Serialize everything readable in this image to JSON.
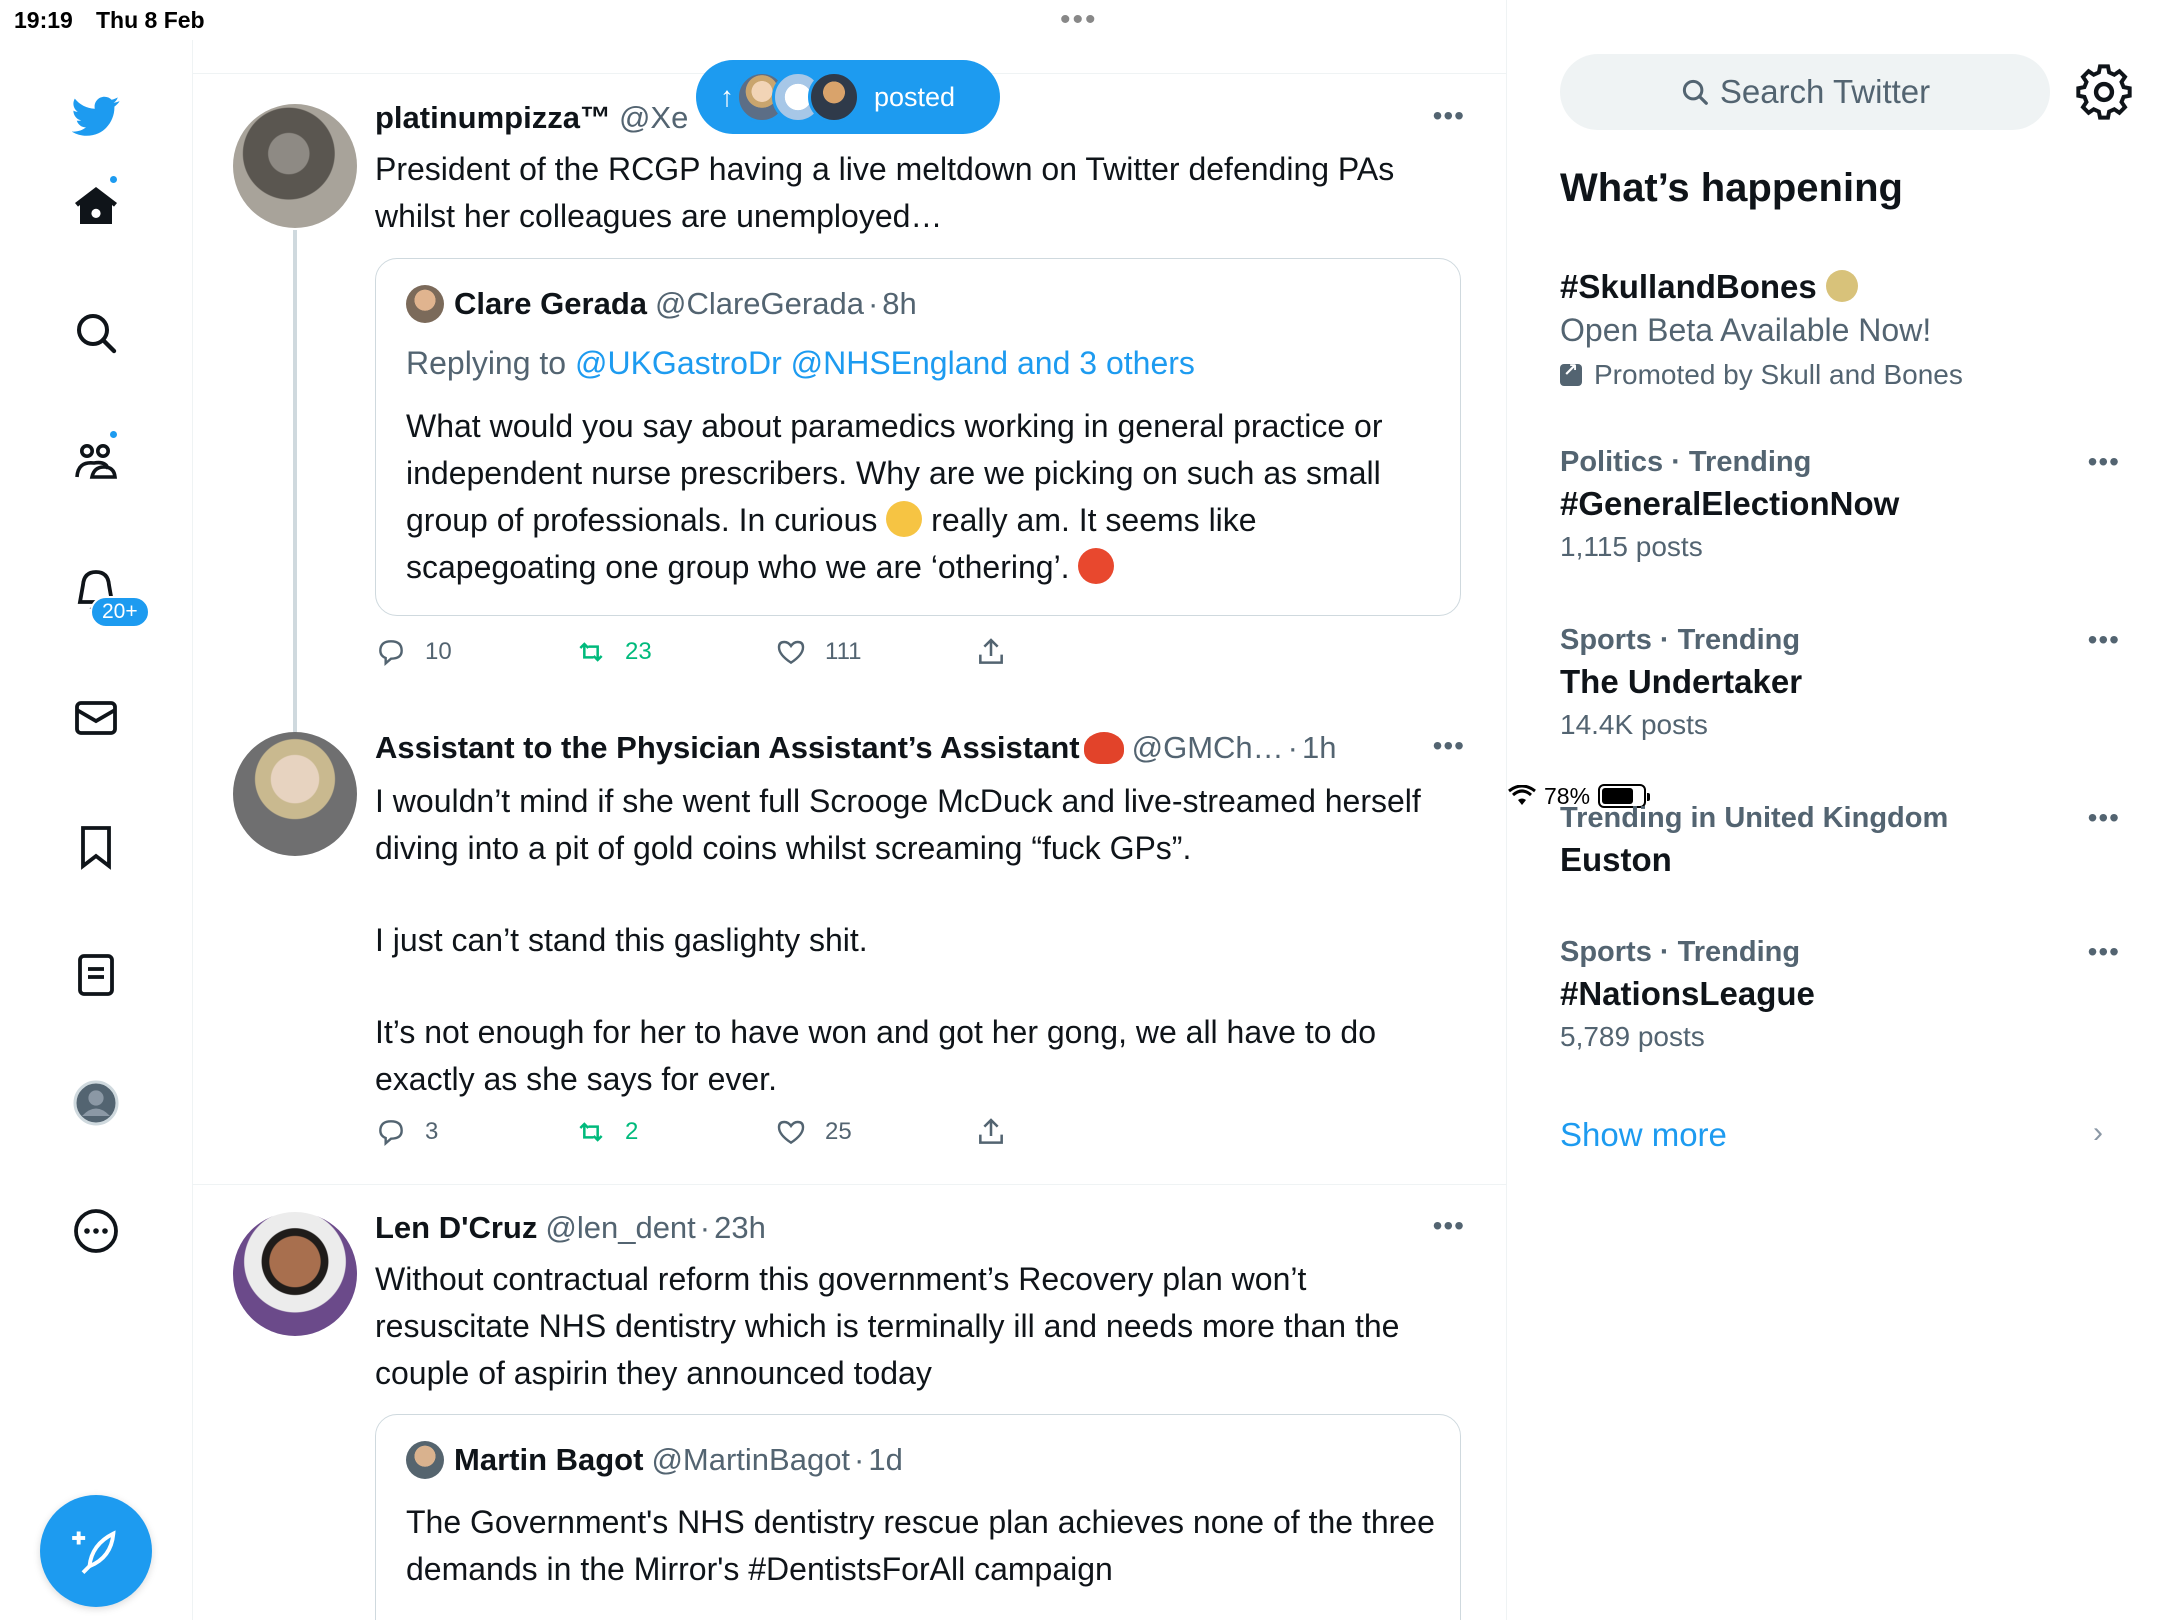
{
  "status_bar": {
    "time": "19:19",
    "date": "Thu 8 Feb",
    "battery": "78%",
    "battery_level": 0.78
  },
  "nav": {
    "notifications_badge": "20+",
    "items": [
      "twitter-logo",
      "home",
      "explore",
      "communities",
      "notifications",
      "messages",
      "bookmarks",
      "lists",
      "profile",
      "more"
    ]
  },
  "new_posts_pill": {
    "label": "posted"
  },
  "tweets": [
    {
      "name": "platinumpizza™",
      "handle": "@Xe",
      "time": "",
      "text": "President of the RCGP having a live meltdown on Twitter defending PAs whilst her colleagues are unemployed…",
      "quote": {
        "name": "Clare Gerada",
        "handle": "@ClareGerada",
        "time": "8h",
        "replying_prefix": "Replying to ",
        "replying_to": "@UKGastroDr @NHSEngland and 3 others",
        "text_1": "What would you say about paramedics working in general practice or independent nurse prescribers. Why are we picking on such as small group of professionals. In curious ",
        "text_2": " really am. It seems like scapegoating one group who we are ‘othering’. "
      },
      "replies": "10",
      "retweets": "23",
      "likes": "111"
    },
    {
      "name": "Assistant to the Physician Assistant’s Assistant",
      "handle": "@GMCh…",
      "time": "1h",
      "text_p1": "I wouldn’t mind if she went full Scrooge McDuck and live-streamed herself diving into a pit of gold coins whilst screaming “fuck GPs”.",
      "text_p2": "I just can’t stand this gaslighty shit.",
      "text_p3": "It’s not enough for her to have won and got her gong, we all have to do exactly as she says for ever.",
      "replies": "3",
      "retweets": "2",
      "likes": "25"
    },
    {
      "name": "Len D'Cruz",
      "handle": "@len_dent",
      "time": "23h",
      "text": "Without contractual reform this government’s  Recovery plan won’t resuscitate NHS dentistry which is terminally ill and needs more than the couple of aspirin they announced today",
      "quote": {
        "name": "Martin Bagot",
        "handle": "@MartinBagot",
        "time": "1d",
        "text": "The Government's NHS dentistry rescue plan achieves none of the three demands in the Mirror's #DentistsForAll campaign"
      }
    }
  ],
  "sidebar": {
    "search_placeholder": "Search Twitter",
    "title": "What’s happening",
    "promoted": {
      "name": "#SkullandBones",
      "subtitle": "Open Beta Available Now!",
      "by": "Promoted by Skull and Bones"
    },
    "trends": [
      {
        "context": "Politics · Trending",
        "name": "#GeneralElectionNow",
        "posts": "1,115 posts"
      },
      {
        "context": "Sports · Trending",
        "name": "The Undertaker",
        "posts": "14.4K posts"
      },
      {
        "context": "Trending in United Kingdom",
        "name": "Euston",
        "posts": ""
      },
      {
        "context": "Sports · Trending",
        "name": "#NationsLeague",
        "posts": "5,789 posts"
      }
    ],
    "show_more": "Show more"
  },
  "colors": {
    "accent": "#1d9bf0",
    "retweet": "#00ba7c",
    "secondary_text": "#536471"
  }
}
